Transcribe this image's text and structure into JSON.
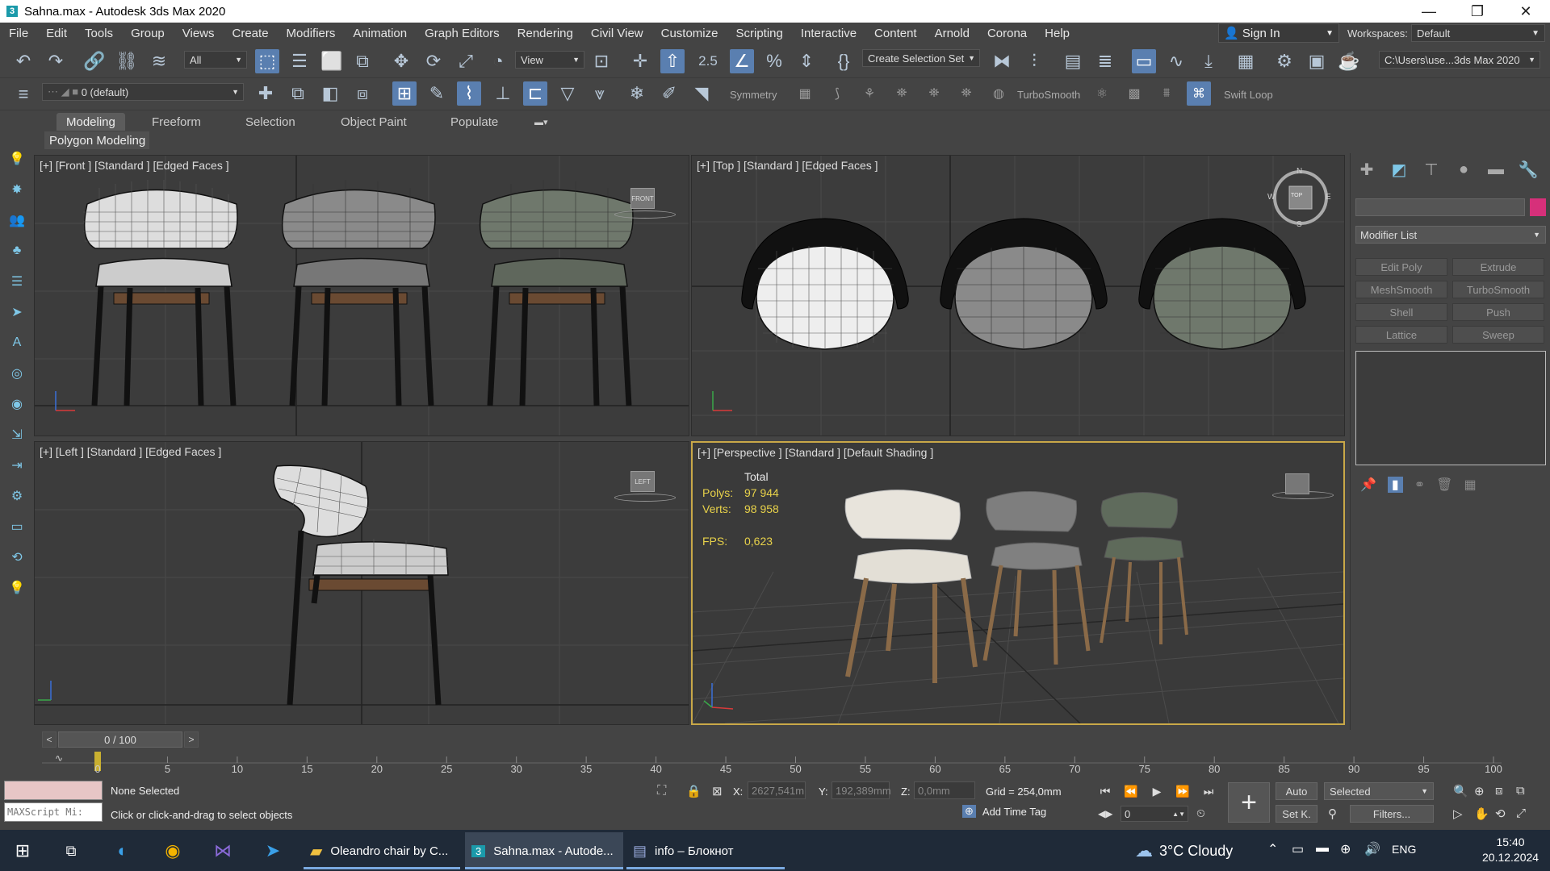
{
  "window": {
    "title": "Sahna.max - Autodesk 3ds Max 2020",
    "logo_text": "3",
    "minimize": "—",
    "maximize": "❐",
    "close": "✕"
  },
  "menu": [
    "File",
    "Edit",
    "Tools",
    "Group",
    "Views",
    "Create",
    "Modifiers",
    "Animation",
    "Graph Editors",
    "Rendering",
    "Civil View",
    "Customize",
    "Scripting",
    "Interactive",
    "Content",
    "Arnold",
    "Corona",
    "Help"
  ],
  "account": {
    "sign_in": "Sign In",
    "workspaces_label": "Workspaces:",
    "workspace": "Default"
  },
  "toolbar1": {
    "filter": "All",
    "ref_coord": "View",
    "selection_set": "Create Selection Set",
    "snap_angle": "2.5",
    "path": "C:\\Users\\use...3ds Max 2020"
  },
  "toolbar2": {
    "layer": "0 (default)",
    "symmetry": "Symmetry",
    "turbosmooth": "TurboSmooth",
    "swift_loop": "Swift Loop"
  },
  "ribbon": {
    "tabs": [
      "Modeling",
      "Freeform",
      "Selection",
      "Object Paint",
      "Populate"
    ],
    "active": "Modeling",
    "panel": "Polygon Modeling"
  },
  "viewports": {
    "front": {
      "label": "[+] [Front ] [Standard ] [Edged Faces ]",
      "cube": "FRONT"
    },
    "top": {
      "label": "[+] [Top ] [Standard ] [Edged Faces ]",
      "cube": "TOP",
      "compass": [
        "N",
        "E",
        "S",
        "W"
      ]
    },
    "left": {
      "label": "[+] [Left ] [Standard ] [Edged Faces ]",
      "cube": "LEFT"
    },
    "perspective": {
      "label": "[+] [Perspective ] [Standard ] [Default Shading ]",
      "stats": {
        "total_label": "Total",
        "polys_label": "Polys:",
        "polys": "97 944",
        "verts_label": "Verts:",
        "verts": "98 958",
        "fps_label": "FPS:",
        "fps": "0,623"
      }
    }
  },
  "command_panel": {
    "modifier_list": "Modifier List",
    "buttons": [
      "Edit Poly",
      "Extrude",
      "MeshSmooth",
      "TurboSmooth",
      "Shell",
      "Push",
      "Lattice",
      "Sweep"
    ],
    "object_color": "#d6307a"
  },
  "timeline": {
    "frame": "0 / 100",
    "ticks": [
      "0",
      "5",
      "10",
      "15",
      "20",
      "25",
      "30",
      "35",
      "40",
      "45",
      "50",
      "55",
      "60",
      "65",
      "70",
      "75",
      "80",
      "85",
      "90",
      "95",
      "100"
    ]
  },
  "status": {
    "selection": "None Selected",
    "prompt": "Click or click-and-drag to select objects",
    "maxscript": "MAXScript Mi:",
    "x_label": "X:",
    "x": "2627,541m",
    "y_label": "Y:",
    "y": "192,389mm",
    "z_label": "Z:",
    "z": "0,0mm",
    "grid": "Grid = 254,0mm",
    "add_time_tag": "Add Time Tag",
    "auto": "Auto",
    "set_key": "Set K.",
    "key_filter": "Selected",
    "filters": "Filters...",
    "frame": "0"
  },
  "taskbar": {
    "apps": [
      {
        "label": "Oleandro chair by C...",
        "icon": "folder-icon"
      },
      {
        "label": "Sahna.max - Autode...",
        "icon": "3dsmax-icon"
      },
      {
        "label": "info – Блокнот",
        "icon": "notepad-icon"
      }
    ],
    "weather": "3°C  Cloudy",
    "lang": "ENG",
    "time": "15:40",
    "date": "20.12.2024"
  },
  "colors": {
    "active_viewport": "#c9a848",
    "stats": "#e8d24a",
    "highlight": "#5a7fb0"
  }
}
